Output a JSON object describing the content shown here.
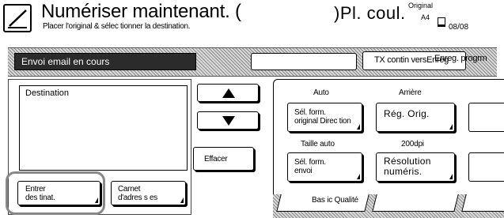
{
  "header": {
    "title": "Numériser maintenant. (",
    "subtitle": "Placer l'original & sélec tionner la destination.",
    "right_text": ")Pl. coul.",
    "original_label": "Original",
    "original_size": "A4",
    "page_count": "08/08"
  },
  "status_bar": {
    "message": "Envoi email en cours",
    "field_value": "",
    "tx_button_label": "TX contin versEnreg",
    "tx_overflow_text": "Enreg. progrm"
  },
  "destination": {
    "label": "Destination",
    "entries": []
  },
  "buttons": {
    "enter_dest_line1": "Entrer",
    "enter_dest_line2": "des tinat.",
    "address_book_line1": "Carnet",
    "address_book_line2": "d'adres s es",
    "clear": "Effacer"
  },
  "options": {
    "auto_label": "Auto",
    "back_label": "Arrière",
    "format_orig_line1": "Sél. form.",
    "format_orig_line2": "original Direc tion",
    "orig_settings_line1": "Rég. Orig.",
    "size_auto_label": "Taille auto",
    "dpi_label": "200dpi",
    "send_format_line1": "Sél. form.",
    "send_format_line2": "envoi",
    "resolution_line1": "Résolution",
    "resolution_line2": "numéris."
  },
  "tabs": {
    "basic_quality": "Bas ic Qualité",
    "second": ""
  }
}
